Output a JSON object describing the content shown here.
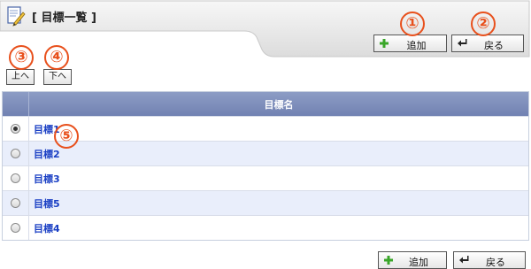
{
  "header": {
    "title": "[ 目標一覧 ]",
    "icon": "edit-document-icon"
  },
  "toolbar": {
    "add_label": "追加",
    "back_label": "戻る",
    "move_up_label": "上へ",
    "move_down_label": "下へ"
  },
  "callouts": [
    "①",
    "②",
    "③",
    "④",
    "⑤"
  ],
  "table": {
    "column_header": "目標名",
    "rows": [
      {
        "name": "目標1",
        "selected": true
      },
      {
        "name": "目標2",
        "selected": false
      },
      {
        "name": "目標3",
        "selected": false
      },
      {
        "name": "目標5",
        "selected": false
      },
      {
        "name": "目標4",
        "selected": false
      }
    ]
  },
  "colors": {
    "callout": "#e8501c",
    "header_bar": "#7f90bc",
    "link": "#1a3fc4",
    "row_alt": "#e9eefb",
    "add_icon": "#3aa629"
  }
}
